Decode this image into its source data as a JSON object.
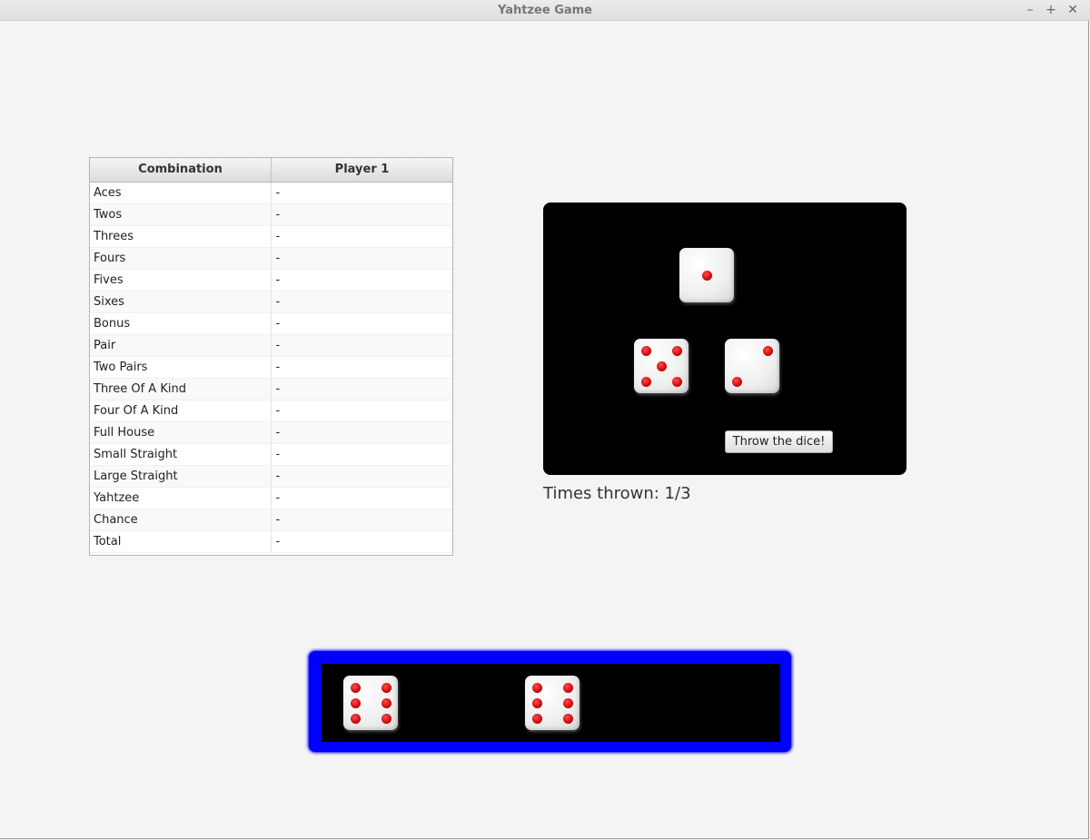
{
  "window": {
    "title": "Yahtzee Game",
    "buttons": {
      "minimize": "–",
      "maximize": "+",
      "close": "✕"
    }
  },
  "score_table": {
    "headers": [
      "Combination",
      "Player 1"
    ],
    "rows": [
      [
        "Aces",
        "-"
      ],
      [
        "Twos",
        "-"
      ],
      [
        "Threes",
        "-"
      ],
      [
        "Fours",
        "-"
      ],
      [
        "Fives",
        "-"
      ],
      [
        "Sixes",
        "-"
      ],
      [
        "Bonus",
        "-"
      ],
      [
        "Pair",
        "-"
      ],
      [
        "Two Pairs",
        "-"
      ],
      [
        "Three Of A Kind",
        "-"
      ],
      [
        "Four Of A Kind",
        "-"
      ],
      [
        "Full House",
        "-"
      ],
      [
        "Small Straight",
        "-"
      ],
      [
        "Large Straight",
        "-"
      ],
      [
        "Yahtzee",
        "-"
      ],
      [
        "Chance",
        "-"
      ],
      [
        "Total",
        "-"
      ]
    ]
  },
  "board": {
    "dice_values": [
      1,
      5,
      2
    ],
    "throw_button": "Throw the dice!",
    "times_thrown": "Times thrown: 1/3"
  },
  "kept_dice": {
    "dice_values": [
      6,
      6
    ]
  },
  "colors": {
    "board": "#000000",
    "tray_border": "#0000ff",
    "pip": "#cc0000"
  }
}
